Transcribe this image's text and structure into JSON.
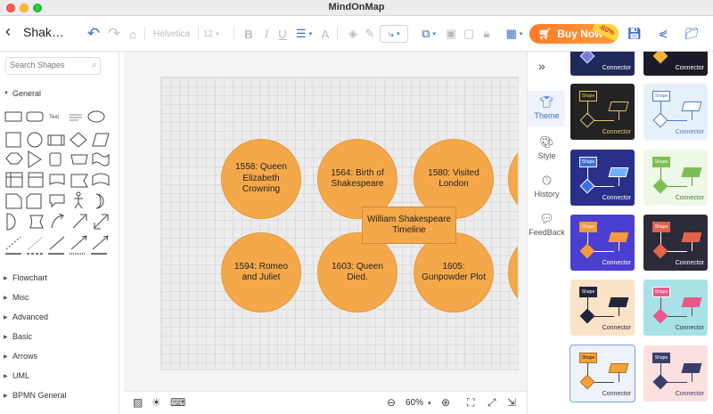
{
  "window": {
    "title": "MindOnMap"
  },
  "toolbar": {
    "back_icon": "chevron-left-icon",
    "doc_title": "Shak…",
    "font": "Helvetica",
    "font_size": "12",
    "bold": "B",
    "italic": "I",
    "underline": "U",
    "text_color": "A",
    "buy_now": "Buy Now",
    "discount": "-60%"
  },
  "left_panel": {
    "search_placeholder": "Search Shapes",
    "text_shape_label": "Text",
    "categories": [
      "General",
      "Flowchart",
      "Misc",
      "Advanced",
      "Basic",
      "Arrows",
      "UML",
      "BPMN General"
    ]
  },
  "canvas": {
    "center_node": "William Shakespeare Timeline",
    "nodes": [
      "1558:  Queen Elizabeth Crowning",
      "1564: Birth of Shakespeare",
      "1580: Visited London",
      "1594: Romeo and Juliet",
      "1603: Queen Died.",
      "1605: Gunpowder Plot"
    ],
    "node_color": "#f4a84a"
  },
  "bottom_bar": {
    "zoom": "60%"
  },
  "right_tabs": [
    "Theme",
    "Style",
    "History",
    "FeedBack"
  ],
  "themes": {
    "shape_label": "Shape",
    "connector_label": "Connector"
  }
}
